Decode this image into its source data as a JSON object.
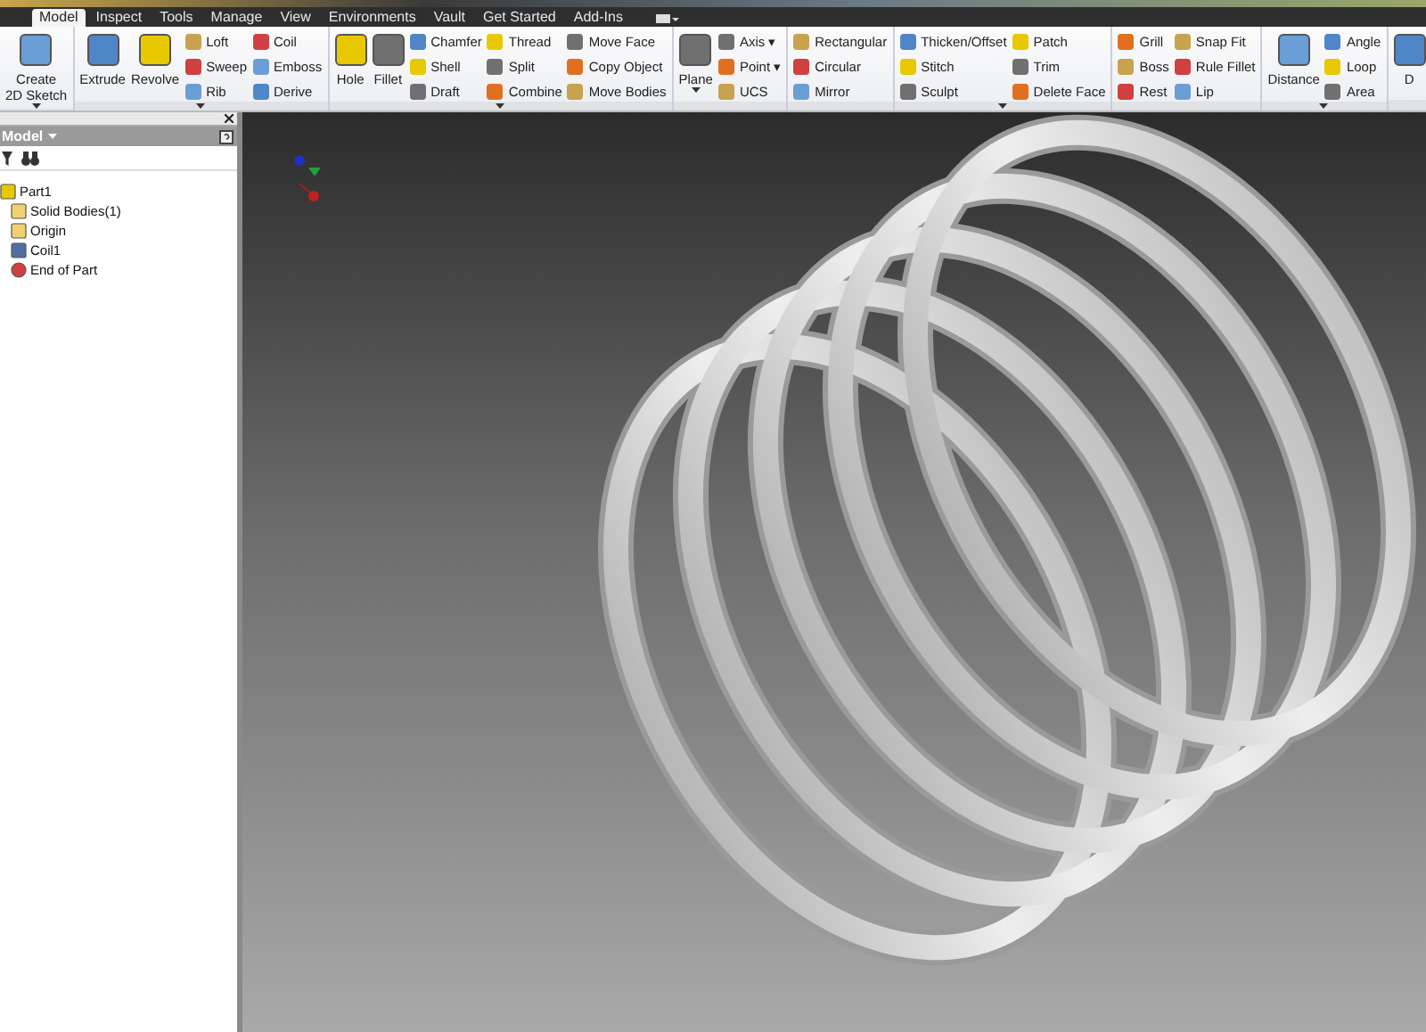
{
  "tabs": [
    {
      "label": "Model",
      "selected": true
    },
    {
      "label": "Inspect",
      "selected": false
    },
    {
      "label": "Tools",
      "selected": false
    },
    {
      "label": "Manage",
      "selected": false
    },
    {
      "label": "View",
      "selected": false
    },
    {
      "label": "Environments",
      "selected": false
    },
    {
      "label": "Vault",
      "selected": false
    },
    {
      "label": "Get Started",
      "selected": false
    },
    {
      "label": "Add-Ins",
      "selected": false
    }
  ],
  "ribbon": {
    "groups": [
      {
        "has_menu": false,
        "items": [
          {
            "kind": "large",
            "label": "Create\n2D Sketch",
            "caret": true
          }
        ]
      },
      {
        "has_menu": true,
        "items": [
          {
            "kind": "large",
            "label": "Extrude",
            "caret": false
          },
          {
            "kind": "large",
            "label": "Revolve",
            "caret": false
          },
          {
            "kind": "column",
            "tools": [
              "Loft",
              "Sweep",
              "Rib"
            ]
          },
          {
            "kind": "column",
            "tools": [
              "Coil",
              "Emboss",
              "Derive"
            ]
          }
        ]
      },
      {
        "has_menu": true,
        "items": [
          {
            "kind": "large",
            "label": "Hole",
            "caret": false
          },
          {
            "kind": "large",
            "label": "Fillet",
            "caret": false
          },
          {
            "kind": "column",
            "tools": [
              "Chamfer",
              "Shell",
              "Draft"
            ]
          },
          {
            "kind": "column",
            "tools": [
              "Thread",
              "Split",
              "Combine"
            ]
          },
          {
            "kind": "column",
            "tools": [
              "Move Face",
              "Copy Object",
              "Move Bodies"
            ]
          }
        ]
      },
      {
        "has_menu": false,
        "items": [
          {
            "kind": "large",
            "label": "Plane",
            "caret": true
          },
          {
            "kind": "column",
            "tools": [
              "Axis ▾",
              "Point ▾",
              "UCS"
            ]
          }
        ]
      },
      {
        "has_menu": false,
        "items": [
          {
            "kind": "column",
            "tools": [
              "Rectangular",
              "Circular",
              "Mirror"
            ]
          }
        ]
      },
      {
        "has_menu": true,
        "items": [
          {
            "kind": "column",
            "tools": [
              "Thicken/Offset",
              "Stitch",
              "Sculpt"
            ]
          },
          {
            "kind": "column",
            "tools": [
              "Patch",
              "Trim",
              "Delete Face"
            ]
          }
        ]
      },
      {
        "has_menu": false,
        "items": [
          {
            "kind": "column",
            "tools": [
              "Grill",
              "Boss",
              "Rest"
            ]
          },
          {
            "kind": "column",
            "tools": [
              "Snap Fit",
              "Rule Fillet",
              "Lip"
            ]
          }
        ]
      },
      {
        "has_menu": true,
        "items": [
          {
            "kind": "large",
            "label": "Distance",
            "caret": false
          },
          {
            "kind": "column",
            "tools": [
              "Angle",
              "Loop",
              "Area"
            ]
          }
        ]
      },
      {
        "has_menu": false,
        "items": [
          {
            "kind": "large",
            "label": "D",
            "caret": false
          }
        ]
      }
    ]
  },
  "browser": {
    "title": "Model",
    "tree": [
      {
        "label": "Part1",
        "kind": "part",
        "children": [
          {
            "label": "Solid Bodies(1)",
            "kind": "folder"
          },
          {
            "label": "Origin",
            "kind": "folder"
          },
          {
            "label": "Coil1",
            "kind": "coil"
          },
          {
            "label": "End of Part",
            "kind": "end"
          }
        ]
      }
    ]
  }
}
